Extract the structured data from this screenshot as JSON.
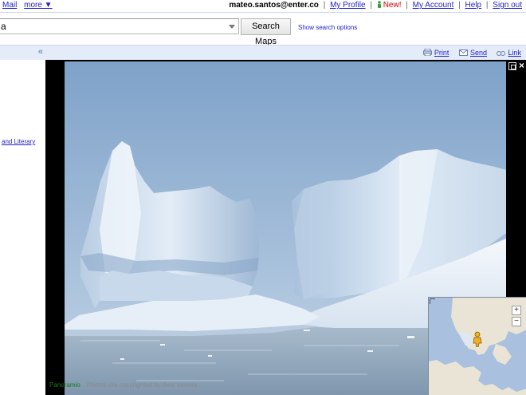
{
  "topbar": {
    "left_links": {
      "mail": "Mail",
      "more": "more ▼"
    },
    "user_email": "mateo.santos@enter.co",
    "my_profile": "My Profile",
    "new_badge": "New!",
    "my_account": "My Account",
    "help": "Help",
    "sign_out": "Sign out",
    "separator": "|"
  },
  "search": {
    "query_value": "a",
    "button_label": "Search Maps",
    "options_link": "Show search options"
  },
  "toolbar": {
    "collapse_label": "«",
    "print_label": "Print",
    "send_label": "Send",
    "link_label": "Link",
    "icons": [
      "print-icon",
      "send-icon",
      "link-icon"
    ]
  },
  "left_panel": {
    "snippet_link": "and Literary"
  },
  "viewer": {
    "close_label": "×",
    "attribution_brand": "Panoramio",
    "attribution_credit": "Photos are copyrighted by their owners"
  },
  "minimap": {
    "zoom_in": "+",
    "zoom_out": "−"
  },
  "colors": {
    "link": "#2222cc",
    "new_badge": "#cc0000",
    "toolbar_bg": "#e5ecf9",
    "viewer_bg": "#000000",
    "sky": "#8fb0d4",
    "ice": "#dce8f5",
    "water": "#9fb4c8"
  }
}
